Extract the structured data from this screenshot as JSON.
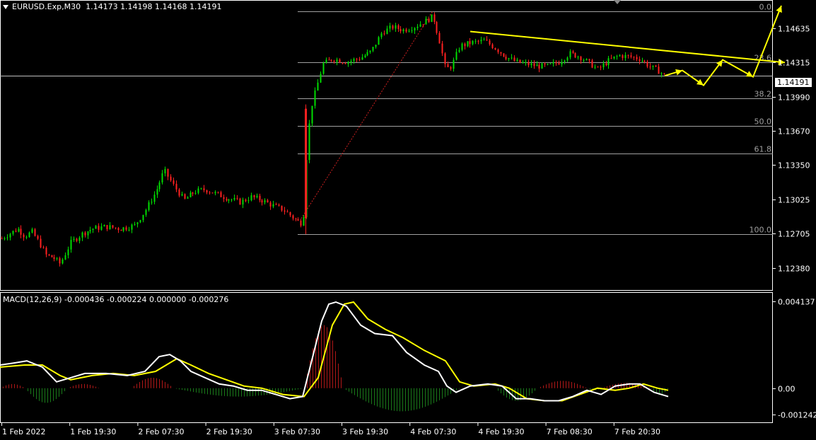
{
  "header": {
    "symbol": "EURUSD.Exp,M30",
    "ohlc": "1.14173 1.14198 1.14168 1.14191"
  },
  "current_price_label": "1.14191",
  "fibonacci_levels": [
    "0.0",
    "23.6",
    "38.2",
    "50.0",
    "61.8",
    "100.0"
  ],
  "macd": {
    "title": "MACD(12,26,9) -0.000436 -0.000224 0.000000 -0.000276",
    "y_ticks": [
      "0.004137",
      "0.00",
      "-0.001242"
    ]
  },
  "colors": {
    "bull_candle": "#00dd00",
    "bear_candle": "#ff2020",
    "trendline_annotations": "#ffff00",
    "macd_main": "#ffffff",
    "macd_signal": "#ffff00",
    "background": "#000000",
    "fib_lines": "#a0a0a0"
  },
  "chart_data": [
    {
      "type": "candlestick",
      "title": "EURUSD.Exp,M30",
      "y_ticks": [
        "1.14635",
        "1.14315",
        "1.13990",
        "1.13670",
        "1.13350",
        "1.13025",
        "1.12705",
        "1.12380"
      ],
      "x_ticks": [
        "1 Feb 2022",
        "1 Feb 19:30",
        "2 Feb 07:30",
        "2 Feb 19:30",
        "3 Feb 07:30",
        "3 Feb 19:30",
        "4 Feb 07:30",
        "4 Feb 19:30",
        "7 Feb 08:30",
        "7 Feb 20:30"
      ],
      "ylim": [
        1.1222,
        1.1485
      ],
      "close_path": [
        [
          0,
          1.1265
        ],
        [
          12,
          1.127
        ],
        [
          25,
          1.1275
        ],
        [
          35,
          1.1268
        ],
        [
          45,
          1.1272
        ],
        [
          55,
          1.1262
        ],
        [
          65,
          1.125
        ],
        [
          75,
          1.1248
        ],
        [
          85,
          1.1242
        ],
        [
          100,
          1.1262
        ],
        [
          115,
          1.127
        ],
        [
          130,
          1.1275
        ],
        [
          150,
          1.1277
        ],
        [
          170,
          1.1275
        ],
        [
          190,
          1.1278
        ],
        [
          205,
          1.1292
        ],
        [
          220,
          1.131
        ],
        [
          232,
          1.133
        ],
        [
          245,
          1.1316
        ],
        [
          260,
          1.1302
        ],
        [
          275,
          1.131
        ],
        [
          290,
          1.1312
        ],
        [
          305,
          1.1308
        ],
        [
          320,
          1.1304
        ],
        [
          340,
          1.13
        ],
        [
          355,
          1.1305
        ],
        [
          370,
          1.1302
        ],
        [
          385,
          1.1297
        ],
        [
          400,
          1.1293
        ],
        [
          415,
          1.1285
        ],
        [
          425,
          1.128
        ],
        [
          430,
          1.129
        ],
        [
          434,
          1.1355
        ],
        [
          440,
          1.139
        ],
        [
          448,
          1.141
        ],
        [
          456,
          1.143
        ],
        [
          470,
          1.1435
        ],
        [
          490,
          1.1432
        ],
        [
          510,
          1.1436
        ],
        [
          525,
          1.1442
        ],
        [
          540,
          1.146
        ],
        [
          555,
          1.1465
        ],
        [
          570,
          1.1462
        ],
        [
          585,
          1.1465
        ],
        [
          600,
          1.147
        ],
        [
          612,
          1.1475
        ],
        [
          622,
          1.145
        ],
        [
          630,
          1.1425
        ],
        [
          638,
          1.1428
        ],
        [
          650,
          1.1447
        ],
        [
          665,
          1.145
        ],
        [
          685,
          1.1452
        ],
        [
          700,
          1.1445
        ],
        [
          715,
          1.1437
        ],
        [
          730,
          1.1432
        ],
        [
          745,
          1.143
        ],
        [
          760,
          1.1428
        ],
        [
          775,
          1.1428
        ],
        [
          790,
          1.1432
        ],
        [
          805,
          1.144
        ],
        [
          820,
          1.1437
        ],
        [
          835,
          1.143
        ],
        [
          845,
          1.1425
        ],
        [
          860,
          1.1433
        ],
        [
          875,
          1.1438
        ],
        [
          890,
          1.1437
        ],
        [
          905,
          1.1435
        ],
        [
          918,
          1.1428
        ],
        [
          930,
          1.1424
        ],
        [
          940,
          1.1419
        ]
      ],
      "fibonacci": {
        "0.0": 1.148,
        "23.6": 1.14315,
        "38.2": 1.1398,
        "50.0": 1.1372,
        "61.8": 1.1346,
        "100.0": 1.127
      },
      "current_price": 1.14191,
      "trendline": [
        [
          665,
          1.14607
        ],
        [
          1110,
          1.14315
        ]
      ],
      "forecast_path": [
        [
          940,
          1.1419
        ],
        [
          965,
          1.1424
        ],
        [
          995,
          1.141
        ],
        [
          1022,
          1.1434
        ],
        [
          1065,
          1.1418
        ],
        [
          1105,
          1.1485
        ]
      ]
    },
    {
      "type": "macd",
      "title": "MACD(12,26,9)",
      "y_ticks": [
        "0.004137",
        "0.00",
        "-0.001242"
      ],
      "ylim": [
        -0.00166,
        0.00457
      ],
      "main_line": [
        [
          0,
          0.0011
        ],
        [
          20,
          0.0012
        ],
        [
          38,
          0.0013
        ],
        [
          60,
          0.001
        ],
        [
          80,
          0.0003
        ],
        [
          100,
          0.0005
        ],
        [
          120,
          0.0007
        ],
        [
          150,
          0.0007
        ],
        [
          180,
          0.0006
        ],
        [
          205,
          0.0008
        ],
        [
          225,
          0.0015
        ],
        [
          240,
          0.0016
        ],
        [
          255,
          0.0013
        ],
        [
          270,
          0.0008
        ],
        [
          290,
          0.0005
        ],
        [
          310,
          0.0002
        ],
        [
          330,
          0.0001
        ],
        [
          350,
          -0.0001
        ],
        [
          370,
          -0.0001
        ],
        [
          390,
          -0.0003
        ],
        [
          410,
          -0.0005
        ],
        [
          428,
          -0.0004
        ],
        [
          440,
          0.0012
        ],
        [
          455,
          0.0032
        ],
        [
          465,
          0.004
        ],
        [
          475,
          0.0041
        ],
        [
          490,
          0.0039
        ],
        [
          510,
          0.003
        ],
        [
          530,
          0.0026
        ],
        [
          555,
          0.0025
        ],
        [
          575,
          0.0017
        ],
        [
          600,
          0.0011
        ],
        [
          620,
          0.0008
        ],
        [
          632,
          0.0001
        ],
        [
          645,
          -0.0002
        ],
        [
          665,
          0.0001
        ],
        [
          690,
          0.0002
        ],
        [
          710,
          0.0001
        ],
        [
          730,
          -0.0005
        ],
        [
          750,
          -0.0005
        ],
        [
          770,
          -0.0006
        ],
        [
          790,
          -0.0006
        ],
        [
          810,
          -0.0004
        ],
        [
          830,
          -0.0001
        ],
        [
          850,
          -0.0003
        ],
        [
          870,
          0.0001
        ],
        [
          890,
          0.0002
        ],
        [
          905,
          0.0002
        ],
        [
          925,
          -0.0002
        ],
        [
          945,
          -0.0004
        ]
      ],
      "signal_line": [
        [
          0,
          0.001
        ],
        [
          35,
          0.0011
        ],
        [
          60,
          0.0011
        ],
        [
          85,
          0.0006
        ],
        [
          100,
          0.0004
        ],
        [
          130,
          0.0006
        ],
        [
          160,
          0.0007
        ],
        [
          190,
          0.0006
        ],
        [
          220,
          0.0008
        ],
        [
          250,
          0.0014
        ],
        [
          270,
          0.0011
        ],
        [
          295,
          0.0007
        ],
        [
          320,
          0.0004
        ],
        [
          345,
          0.0001
        ],
        [
          370,
          0.0
        ],
        [
          400,
          -0.0003
        ],
        [
          430,
          -0.0004
        ],
        [
          450,
          0.0005
        ],
        [
          470,
          0.003
        ],
        [
          487,
          0.004
        ],
        [
          500,
          0.0041
        ],
        [
          520,
          0.0033
        ],
        [
          545,
          0.0028
        ],
        [
          570,
          0.0024
        ],
        [
          600,
          0.0018
        ],
        [
          630,
          0.0013
        ],
        [
          650,
          0.0003
        ],
        [
          670,
          0.0001
        ],
        [
          700,
          0.0002
        ],
        [
          720,
          0.0
        ],
        [
          745,
          -0.0005
        ],
        [
          770,
          -0.0006
        ],
        [
          795,
          -0.0006
        ],
        [
          820,
          -0.0003
        ],
        [
          845,
          0.0
        ],
        [
          870,
          -0.0001
        ],
        [
          890,
          0.0
        ],
        [
          910,
          0.0002
        ],
        [
          930,
          0.0
        ],
        [
          945,
          -0.0001
        ]
      ],
      "histogram_bull": [
        [
          0,
          35,
          0.0002
        ],
        [
          95,
          140,
          0.0002
        ],
        [
          185,
          245,
          0.0005
        ],
        [
          430,
          485,
          0.003
        ],
        [
          760,
          830,
          0.00035
        ],
        [
          850,
          920,
          0.00025
        ]
      ],
      "histogram_bear": [
        [
          35,
          95,
          -0.0007
        ],
        [
          245,
          430,
          -0.0004
        ],
        [
          485,
          650,
          -0.0011
        ],
        [
          700,
          760,
          -0.0006
        ],
        [
          830,
          850,
          -0.0001
        ],
        [
          920,
          945,
          -0.0003
        ]
      ]
    }
  ]
}
